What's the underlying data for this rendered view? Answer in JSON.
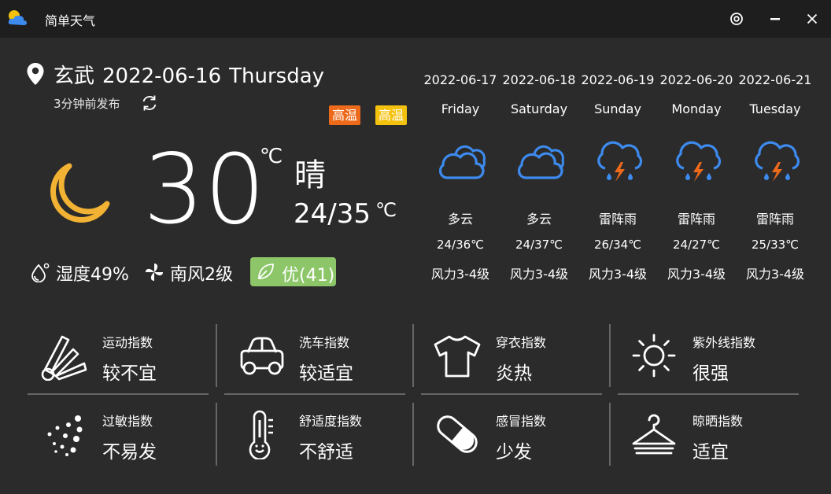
{
  "window": {
    "title": "简单天气",
    "controls": {
      "settings_icon": "settings-gear-icon",
      "minimize_icon": "minimize-icon",
      "close_icon": "close-icon"
    }
  },
  "current": {
    "location": "玄武",
    "date": "2022-06-16",
    "weekday": "Thursday",
    "published": "3分钟前发布",
    "alerts": [
      "高温",
      "高温"
    ],
    "alert_colors": [
      "#ee6a1b",
      "#f4c10e"
    ],
    "temperature": "30",
    "temp_unit": "℃",
    "condition": "晴",
    "range": "24/35",
    "range_unit": "℃",
    "humidity": "湿度49%",
    "wind": "南风2级",
    "aqi": "优(41)",
    "aqi_color": "#8cc668",
    "icon": "moon-icon"
  },
  "forecast": [
    {
      "date": "2022-06-17",
      "weekday": "Friday",
      "condition": "多云",
      "range": "24/36℃",
      "wind": "风力3-4级",
      "icon": "cloudy-icon"
    },
    {
      "date": "2022-06-18",
      "weekday": "Saturday",
      "condition": "多云",
      "range": "24/37℃",
      "wind": "风力3-4级",
      "icon": "cloudy-icon"
    },
    {
      "date": "2022-06-19",
      "weekday": "Sunday",
      "condition": "雷阵雨",
      "range": "26/34℃",
      "wind": "风力3-4级",
      "icon": "thunderstorm-icon"
    },
    {
      "date": "2022-06-20",
      "weekday": "Monday",
      "condition": "雷阵雨",
      "range": "24/27℃",
      "wind": "风力3-4级",
      "icon": "thunderstorm-icon"
    },
    {
      "date": "2022-06-21",
      "weekday": "Tuesday",
      "condition": "雷阵雨",
      "range": "25/33℃",
      "wind": "风力3-4级",
      "icon": "thunderstorm-icon"
    }
  ],
  "indices": [
    {
      "name": "运动指数",
      "value": "较不宜",
      "icon": "shuttlecock-icon"
    },
    {
      "name": "洗车指数",
      "value": "较适宜",
      "icon": "car-icon"
    },
    {
      "name": "穿衣指数",
      "value": "炎热",
      "icon": "tshirt-icon"
    },
    {
      "name": "紫外线指数",
      "value": "很强",
      "icon": "sun-icon"
    },
    {
      "name": "过敏指数",
      "value": "不易发",
      "icon": "pollen-icon"
    },
    {
      "name": "舒适度指数",
      "value": "不舒适",
      "icon": "thermometer-face-icon"
    },
    {
      "name": "感冒指数",
      "value": "少发",
      "icon": "pill-icon"
    },
    {
      "name": "晾晒指数",
      "value": "适宜",
      "icon": "hanger-icon"
    }
  ],
  "colors": {
    "background": "#2b2b2b",
    "titlebar": "#1e1e1e",
    "weather_blue": "#3d8bef",
    "lightning": "#ee6a1b",
    "moon": "#f2b233"
  }
}
